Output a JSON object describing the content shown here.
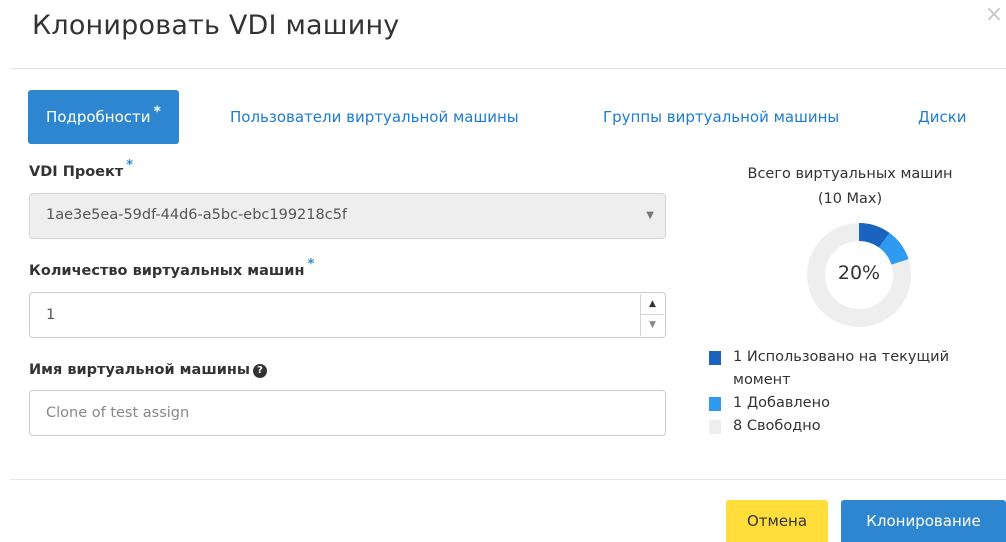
{
  "modal": {
    "title": "Клонировать VDI машину",
    "close_glyph": "×"
  },
  "tabs": [
    {
      "label": "Подробности",
      "required_mark": "*",
      "active": true
    },
    {
      "label": "Пользователи виртуальной машины",
      "active": false
    },
    {
      "label": "Группы виртуальной машины",
      "active": false
    },
    {
      "label": "Диски",
      "active": false
    }
  ],
  "form": {
    "project": {
      "label": "VDI Проект",
      "required_mark": "*",
      "value": "1ae3e5ea-59df-44d6-a5bc-ebc199218c5f"
    },
    "count": {
      "label": "Количество виртуальных машин",
      "required_mark": "*",
      "value": "1"
    },
    "name": {
      "label": "Имя виртуальной машины",
      "placeholder": "Clone of test assign",
      "help_icon": "question-circle-icon"
    }
  },
  "quota": {
    "title_line1": "Всего виртуальных машин",
    "title_line2": "(10 Max)",
    "percent_label": "20%",
    "max": 10,
    "used": 1,
    "added": 1,
    "free": 8,
    "colors": {
      "used": "#1a64c0",
      "added": "#2f9bf0",
      "free": "#eeeeee"
    },
    "legend": [
      {
        "count": "1",
        "label": "Использовано на текущий",
        "label2": "момент",
        "color": "#1a64c0"
      },
      {
        "count": "1",
        "label": "Добавлено",
        "color": "#2f9bf0"
      },
      {
        "count": "8",
        "label": "Свободно",
        "color": "#eeeeee"
      }
    ]
  },
  "footer": {
    "cancel_label": "Отмена",
    "submit_label": "Клонирование"
  },
  "colors": {
    "primary": "#2f86d0",
    "cancel": "#ffde3b"
  }
}
